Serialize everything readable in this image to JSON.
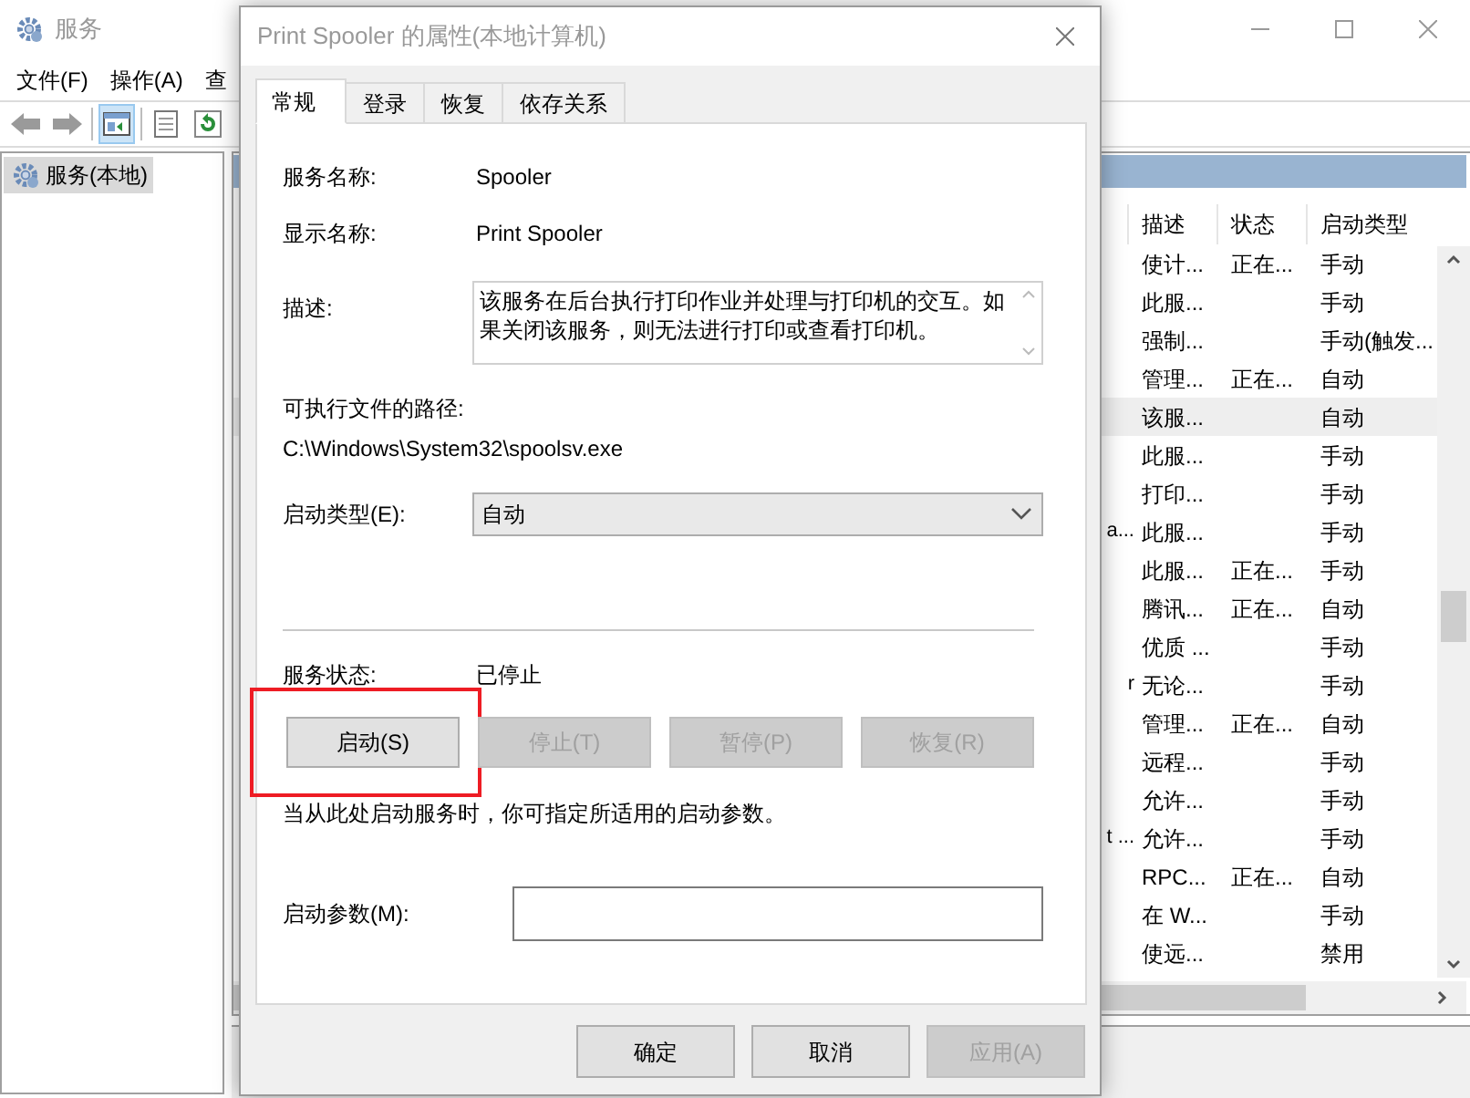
{
  "main_window": {
    "title": "服务",
    "menu": [
      "文件(F)",
      "操作(A)",
      "查"
    ],
    "toolbar": [
      {
        "kind": "back",
        "selected": false
      },
      {
        "kind": "forward",
        "selected": false
      },
      {
        "kind": "tree",
        "selected": true
      },
      {
        "kind": "properties",
        "selected": false
      },
      {
        "kind": "refresh",
        "selected": false
      }
    ],
    "tree": [
      {
        "label": "服务(本地)",
        "selected": true
      }
    ],
    "table": {
      "columns": [
        "描述",
        "状态",
        "启动类型"
      ],
      "rows": [
        {
          "description": "使计...",
          "status": "正在...",
          "startup_type": "手动",
          "selected": false
        },
        {
          "description": "此服...",
          "startup_type": "手动",
          "selected": false
        },
        {
          "description": "强制...",
          "startup_type": "手动(触发...",
          "selected": false
        },
        {
          "description": "管理...",
          "status": "正在...",
          "startup_type": "自动",
          "selected": false
        },
        {
          "description": "该服...",
          "startup_type": "自动",
          "selected": true
        },
        {
          "description": "此服...",
          "startup_type": "手动",
          "selected": false
        },
        {
          "description": "打印...",
          "startup_type": "手动",
          "selected": false
        },
        {
          "name": "a...",
          "description": "此服...",
          "startup_type": "手动",
          "selected": false
        },
        {
          "description": "此服...",
          "status": "正在...",
          "startup_type": "手动",
          "selected": false
        },
        {
          "description": "腾讯...",
          "status": "正在...",
          "startup_type": "自动",
          "selected": false
        },
        {
          "description": "优质 ...",
          "startup_type": "手动",
          "selected": false
        },
        {
          "name": "r",
          "description": "无论...",
          "startup_type": "手动",
          "selected": false
        },
        {
          "description": "管理...",
          "status": "正在...",
          "startup_type": "自动",
          "selected": false
        },
        {
          "description": "远程...",
          "startup_type": "手动",
          "selected": false
        },
        {
          "description": "允许...",
          "startup_type": "手动",
          "selected": false
        },
        {
          "name": "t ...",
          "description": "允许...",
          "startup_type": "手动",
          "selected": false
        },
        {
          "description": "RPC...",
          "status": "正在...",
          "startup_type": "自动",
          "selected": false
        },
        {
          "description": "在 W...",
          "startup_type": "手动",
          "selected": false
        },
        {
          "description": "使远...",
          "startup_type": "禁用",
          "selected": false
        }
      ]
    }
  },
  "dialog": {
    "title": "Print Spooler 的属性(本地计算机)",
    "tabs": [
      {
        "label": "常规",
        "selected": true
      },
      {
        "label": "登录",
        "selected": false
      },
      {
        "label": "恢复",
        "selected": false
      },
      {
        "label": "依存关系",
        "selected": false
      }
    ],
    "service_name": {
      "label": "服务名称:",
      "value": "Spooler"
    },
    "display_name": {
      "label": "显示名称:",
      "value": "Print Spooler"
    },
    "description": {
      "label": "描述:",
      "value": "该服务在后台执行打印作业并处理与打印机的交互。如果关闭该服务，则无法进行打印或查看打印机。"
    },
    "executable_path": {
      "label": "可执行文件的路径:",
      "value": "C:\\Windows\\System32\\spoolsv.exe"
    },
    "startup_type": {
      "label": "启动类型(E):",
      "value": "自动"
    },
    "service_status": {
      "label": "服务状态:",
      "value": "已停止"
    },
    "control_buttons": [
      {
        "label": "启动(S)",
        "disabled": false,
        "highlighted": true
      },
      {
        "label": "停止(T)",
        "disabled": true,
        "highlighted": false
      },
      {
        "label": "暂停(P)",
        "disabled": true,
        "highlighted": false
      },
      {
        "label": "恢复(R)",
        "disabled": true,
        "highlighted": false
      }
    ],
    "hint": "当从此处启动服务时，你可指定所适用的启动参数。",
    "start_parameters": {
      "label": "启动参数(M):"
    },
    "footer_buttons": [
      {
        "label": "确定",
        "disabled": false
      },
      {
        "label": "取消",
        "disabled": false
      },
      {
        "label": "应用(A)",
        "disabled": true
      }
    ]
  }
}
